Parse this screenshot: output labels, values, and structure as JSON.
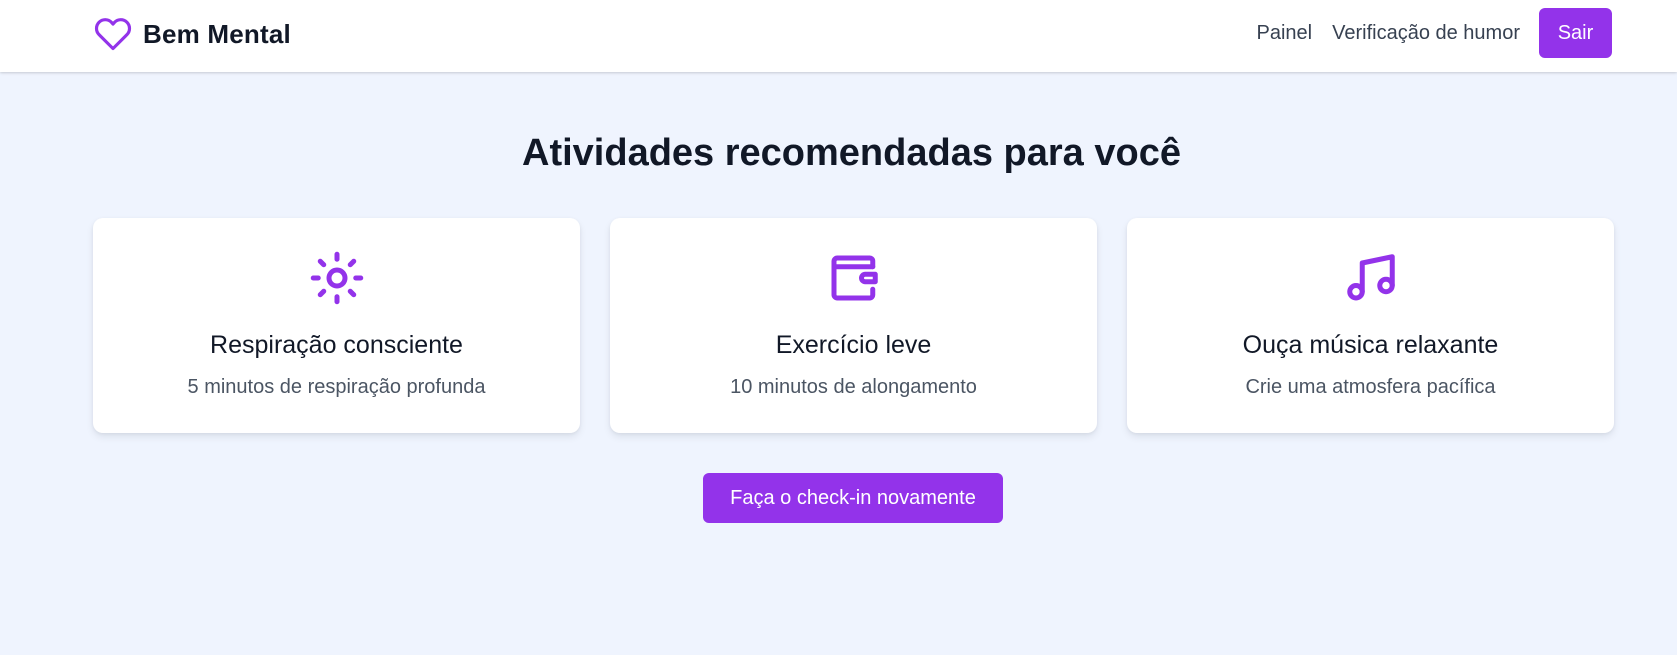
{
  "colors": {
    "accent": "#9333ea",
    "background": "#eff4fe",
    "card": "#ffffff",
    "text_primary": "#111827",
    "text_secondary": "#4b5563"
  },
  "navbar": {
    "brand": {
      "icon": "heart-icon",
      "name": "Bem Mental"
    },
    "links": [
      {
        "label": "Painel"
      },
      {
        "label": "Verificação de humor"
      }
    ],
    "logout_label": "Sair"
  },
  "main": {
    "title": "Atividades recomendadas para você",
    "activities": [
      {
        "icon": "sun-icon",
        "title": "Respiração consciente",
        "description": "5 minutos de respiração profunda"
      },
      {
        "icon": "wallet-icon",
        "title": "Exercício leve",
        "description": "10 minutos de alongamento"
      },
      {
        "icon": "music-note-icon",
        "title": "Ouça música relaxante",
        "description": "Crie uma atmosfera pacífica"
      }
    ],
    "checkin_label": "Faça o check-in novamente"
  }
}
